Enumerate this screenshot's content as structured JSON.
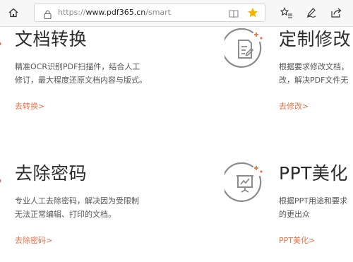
{
  "browser": {
    "url_prefix": "https://",
    "url_host": "www.pdf365.cn",
    "url_path": "/smart",
    "icons": {
      "home": "home-icon",
      "lock": "lock-icon",
      "reader": "reading-view-icon",
      "star": "favorite-star-icon",
      "favorites": "favorites-list-icon",
      "pen": "pen-icon",
      "share": "share-icon"
    },
    "accent_star": "#f2b600"
  },
  "cards": [
    {
      "title": "文档转换",
      "desc_line1": "精准OCR识别PDF扫描件，结合人工",
      "desc_line2": "修订，最大程度还原文档内容与版式。",
      "link": "去转换>"
    },
    {
      "title": "定制修改",
      "desc_line1": "根据要求修改文档，",
      "desc_line2": "改，解决PDF文件无",
      "link": "去修改>",
      "icon": "edit-document-icon"
    },
    {
      "title": "去除密码",
      "desc_line1": "专业人工去除密码，解决因为受限制",
      "desc_line2": "无法正常编辑、打印的文档。",
      "link": "去除密码>"
    },
    {
      "title": "PPT美化",
      "desc_line1": "根据PPT用途和要求",
      "desc_line2": "的更出众",
      "link": "PPT美化>",
      "icon": "presentation-board-icon"
    }
  ],
  "colors": {
    "link": "#e8724a",
    "title": "#2b2b2b",
    "text": "#555555",
    "icon_gray": "#8c8c8c"
  }
}
